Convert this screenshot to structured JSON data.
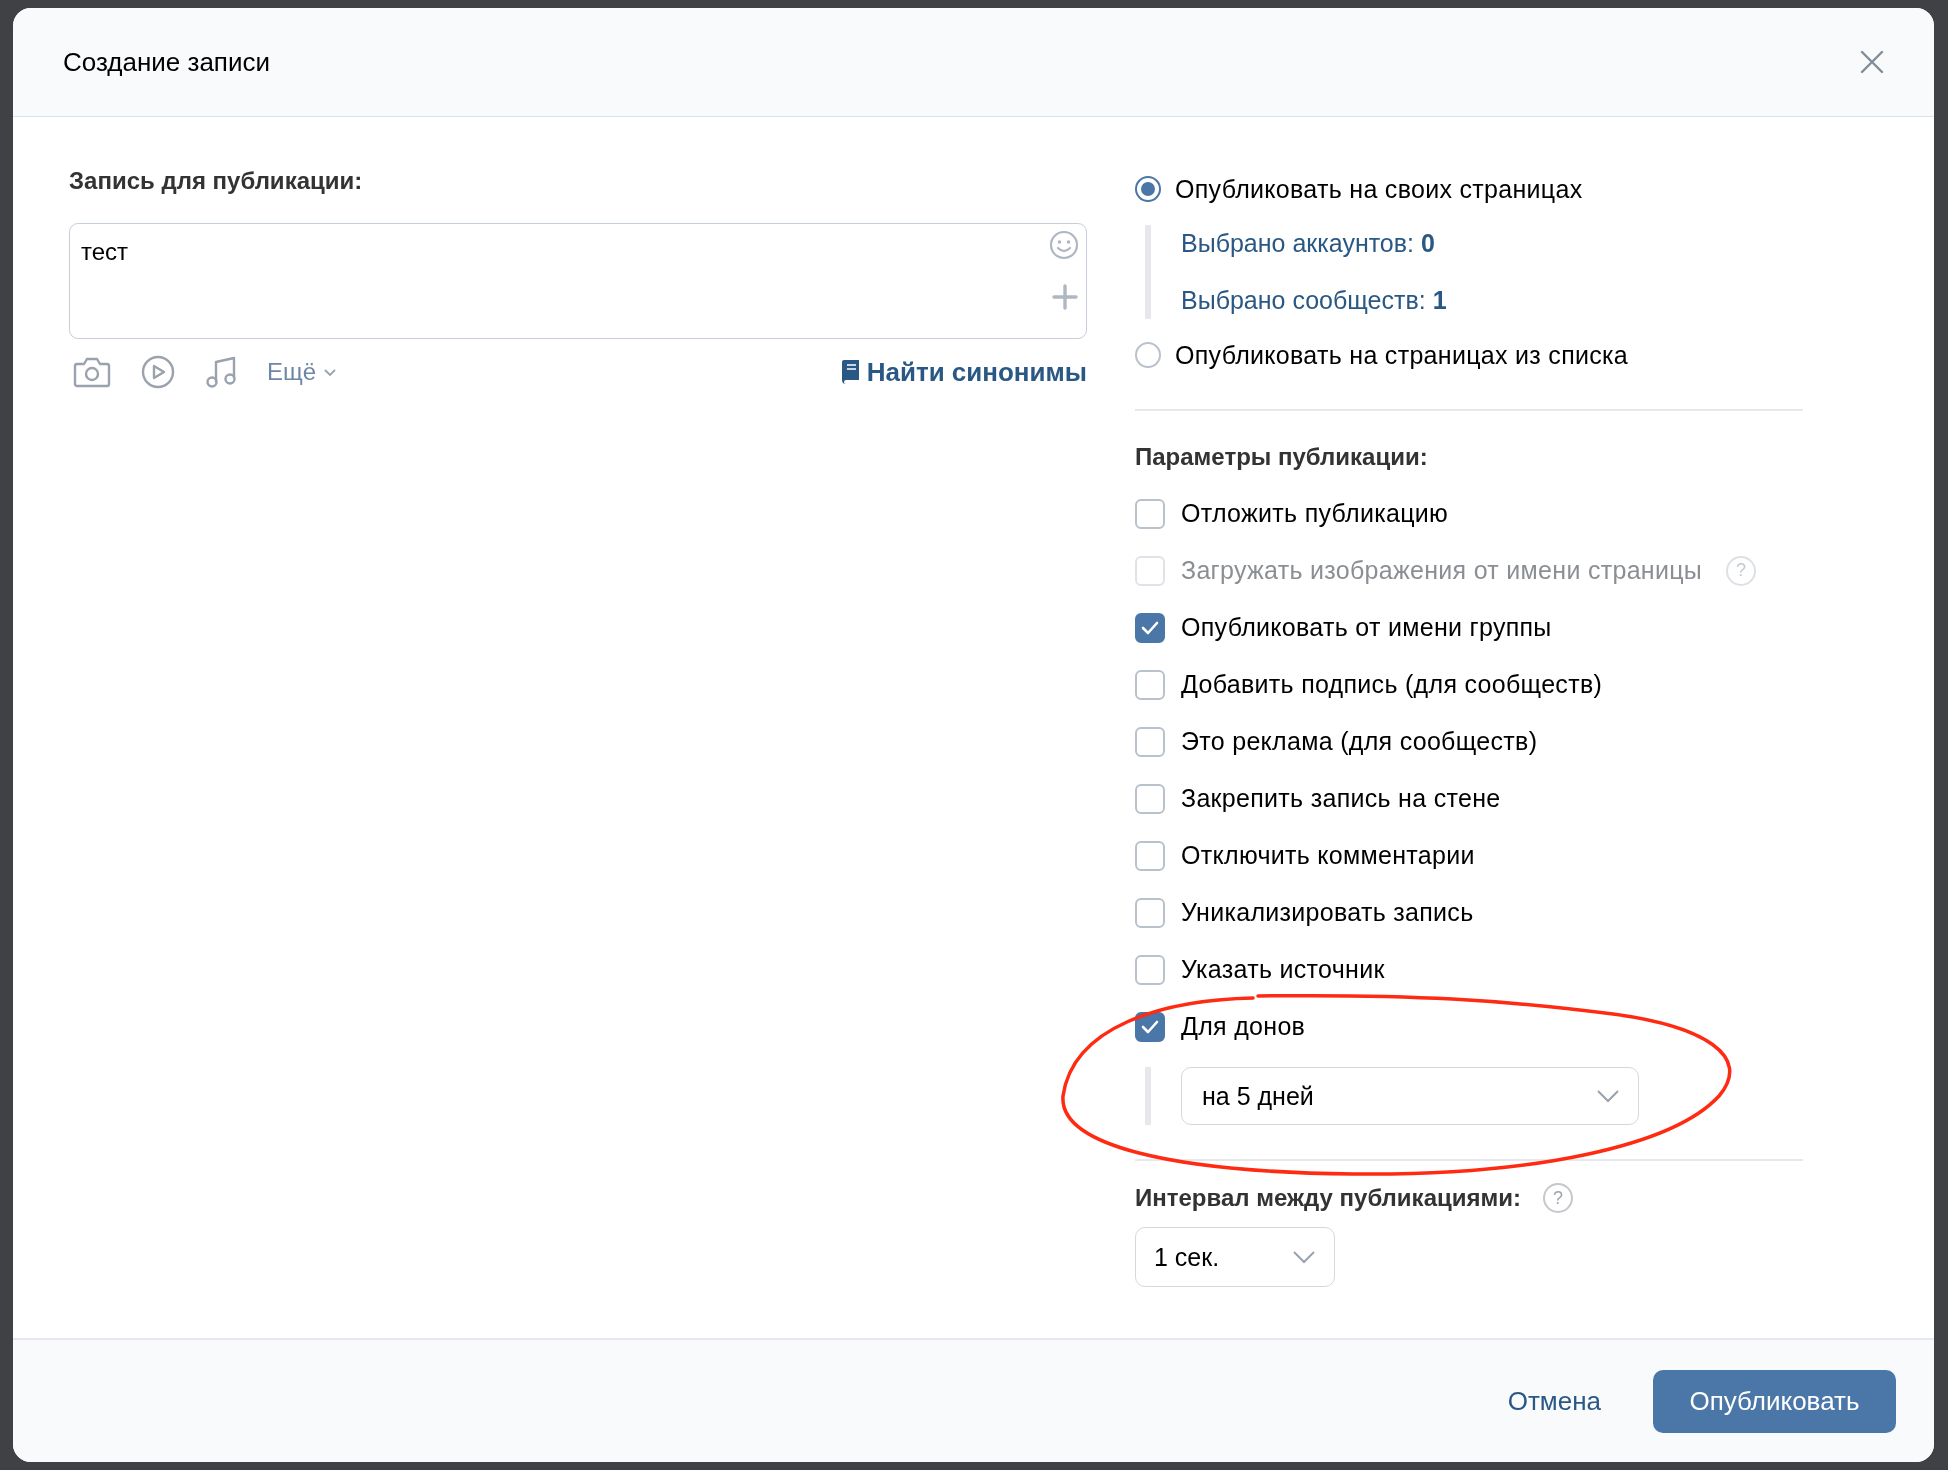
{
  "dialog": {
    "title": "Создание записи"
  },
  "post": {
    "label": "Запись для публикации:",
    "value": "тест",
    "more_label": "Ещё",
    "synonyms_link": "Найти синонимы"
  },
  "targets": [
    {
      "label": "Опубликовать на своих страницах",
      "selected": true,
      "details": [
        "Выбрано аккаунтов: **0**",
        "Выбрано сообществ: **1**"
      ]
    },
    {
      "label": "Опубликовать на страницах из списка",
      "selected": false
    }
  ],
  "options_title": "Параметры публикации:",
  "options": [
    {
      "label": "Отложить публикацию",
      "checked": false,
      "disabled": false
    },
    {
      "label": "Загружать изображения от имени страницы",
      "checked": false,
      "disabled": true,
      "help": "?"
    },
    {
      "label": "Опубликовать от имени группы",
      "checked": true,
      "disabled": false
    },
    {
      "label": "Добавить подпись (для сообществ)",
      "checked": false,
      "disabled": false
    },
    {
      "label": "Это реклама (для сообществ)",
      "checked": false,
      "disabled": false
    },
    {
      "label": "Закрепить запись на стене",
      "checked": false,
      "disabled": false
    },
    {
      "label": "Отключить комментарии",
      "checked": false,
      "disabled": false
    },
    {
      "label": "Уникализировать запись",
      "checked": false,
      "disabled": false
    },
    {
      "label": "Указать источник",
      "checked": false,
      "disabled": false
    },
    {
      "label": "Для донов",
      "checked": true,
      "disabled": false,
      "select": "на 5 дней"
    }
  ],
  "interval": {
    "label": "Интервал между публикациями:",
    "help": "?",
    "value": "1 сек."
  },
  "buttons": {
    "cancel": "Отмена",
    "publish": "Опубликовать"
  }
}
